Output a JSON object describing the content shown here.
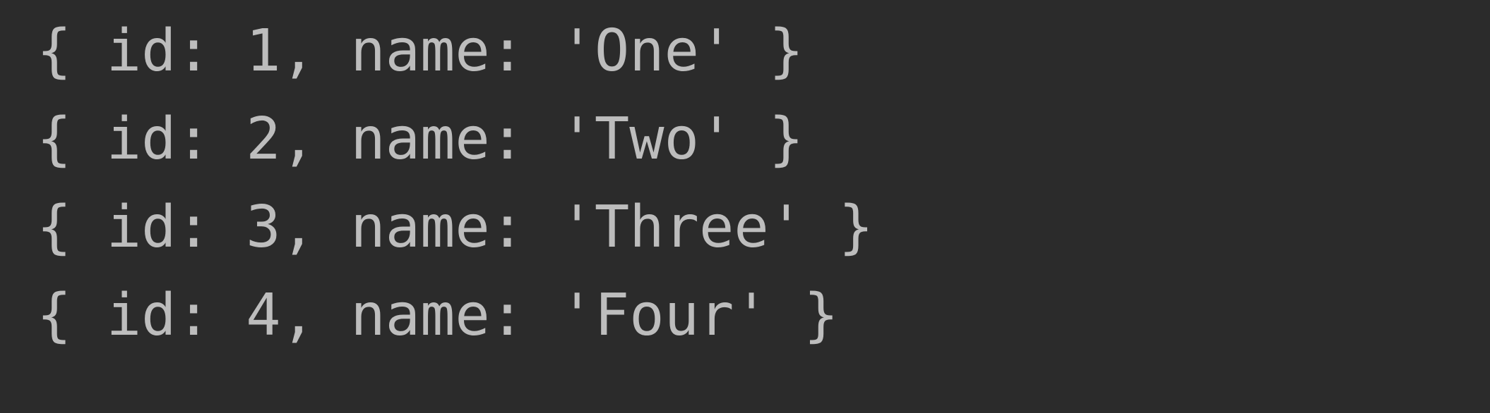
{
  "console": {
    "lines": [
      "{ id: 1, name: 'One' }",
      "{ id: 2, name: 'Two' }",
      "{ id: 3, name: 'Three' }",
      "{ id: 4, name: 'Four' }"
    ]
  },
  "colors": {
    "background": "#2b2b2b",
    "text": "#bdbdbd"
  }
}
